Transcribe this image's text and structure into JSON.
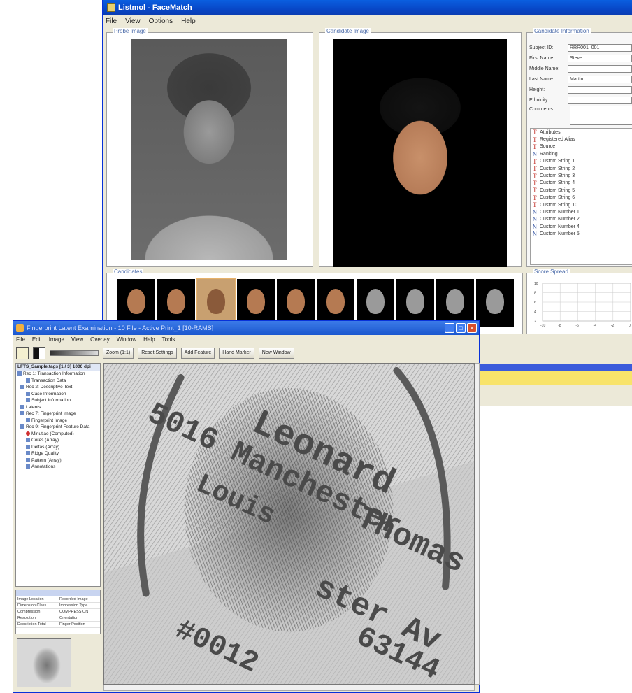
{
  "window1": {
    "title": "Listmol - FaceMatch",
    "menu": [
      "File",
      "View",
      "Options",
      "Help"
    ],
    "probe_panel_title": "Probe Image",
    "candidate_panel_title": "Candidate Image",
    "info_panel_title": "Candidate Information",
    "fields": [
      {
        "label": "Subject ID:",
        "value": "RRR001_001"
      },
      {
        "label": "First Name:",
        "value": "Steve"
      },
      {
        "label": "Middle Name:",
        "value": ""
      },
      {
        "label": "Last Name:",
        "value": "Martin"
      },
      {
        "label": "Height:",
        "value": ""
      },
      {
        "label": "Ethnicity:",
        "value": ""
      },
      {
        "label": "Comments:",
        "value": ""
      }
    ],
    "attributes": [
      {
        "type": "T",
        "label": "Attributes"
      },
      {
        "type": "T",
        "label": "Registered Alias"
      },
      {
        "type": "T",
        "label": "Source"
      },
      {
        "type": "N",
        "label": "Ranking"
      },
      {
        "type": "T",
        "label": "Custom String 1"
      },
      {
        "type": "T",
        "label": "Custom String 2"
      },
      {
        "type": "T",
        "label": "Custom String 3"
      },
      {
        "type": "T",
        "label": "Custom String 4"
      },
      {
        "type": "T",
        "label": "Custom String 5"
      },
      {
        "type": "T",
        "label": "Custom String 6"
      },
      {
        "type": "T",
        "label": "Custom String 10"
      },
      {
        "type": "N",
        "label": "Custom Number 1"
      },
      {
        "type": "N",
        "label": "Custom Number 2"
      },
      {
        "type": "N",
        "label": "Custom Number 4"
      },
      {
        "type": "N",
        "label": "Custom Number 5"
      }
    ],
    "candidates_panel_title": "Candidates",
    "candidates": [
      "color",
      "color",
      "selected",
      "color",
      "color",
      "color",
      "gray",
      "gray",
      "gray",
      "gray"
    ],
    "score_panel_title": "Score Spread",
    "score_axis": {
      "y_ticks": [
        "10",
        "8",
        "6",
        "4",
        "2"
      ],
      "x_ticks": [
        "-10",
        "-8",
        "-6",
        "-4",
        "-2",
        "0"
      ]
    }
  },
  "window2": {
    "title": "Fingerprint Latent Examination - 10 File - Active Print_1 [10-RAMS]",
    "menu": [
      "File",
      "Edit",
      "Image",
      "View",
      "Overlay",
      "Window",
      "Help",
      "Tools"
    ],
    "toolbar": {
      "zoom_label": "Zoom (1:1)",
      "reset_label": "Reset Settings",
      "add_feature_label": "Add Feature",
      "hand_mark_label": "Hand Marker",
      "new_window_label": "New Window"
    },
    "tree_header": "LFTS_Sample.tags [1 / 3] 1000 dpi",
    "tree_items": [
      {
        "label": "Rec 1: Transaction Information",
        "icon": "folder"
      },
      {
        "label": "Transaction Data",
        "icon": "doc"
      },
      {
        "label": "Rec 2: Descriptive Text",
        "icon": "folder"
      },
      {
        "label": "Case Information",
        "icon": "doc"
      },
      {
        "label": "Subject Information",
        "icon": "doc"
      },
      {
        "label": "Latents",
        "icon": "folder"
      },
      {
        "label": "Rec 7: Fingerprint Image",
        "icon": "folder"
      },
      {
        "label": "Fingerprint Image",
        "icon": "doc"
      },
      {
        "label": "Rec 9: Fingerprint Feature Data",
        "icon": "folder"
      },
      {
        "label": "Minutiae (Computed)",
        "icon": "red"
      },
      {
        "label": "Cores (Array)",
        "icon": "doc"
      },
      {
        "label": "Deltas (Array)",
        "icon": "doc"
      },
      {
        "label": "Ridge Quality",
        "icon": "doc"
      },
      {
        "label": "Pattern (Array)",
        "icon": "doc"
      },
      {
        "label": "Annotations",
        "icon": "doc"
      }
    ],
    "properties": [
      [
        "Image Location",
        "Recorded Image"
      ],
      [
        "Dimension Class",
        "Impression Type"
      ],
      [
        "Compression",
        "COMPRESSION"
      ],
      [
        "Resolution",
        "Orientation"
      ],
      [
        "Description Total",
        "Finger Position"
      ]
    ],
    "latent_text": {
      "line1": "Leonard",
      "line2": "5016 Manchester",
      "line3": "Louis",
      "line4": "Thomas",
      "line5": "ster Av",
      "line6": "#0012",
      "line7": "63144"
    },
    "colors": {
      "title_blue": "#1b57cf",
      "xp_face": "#ece9d8"
    }
  }
}
